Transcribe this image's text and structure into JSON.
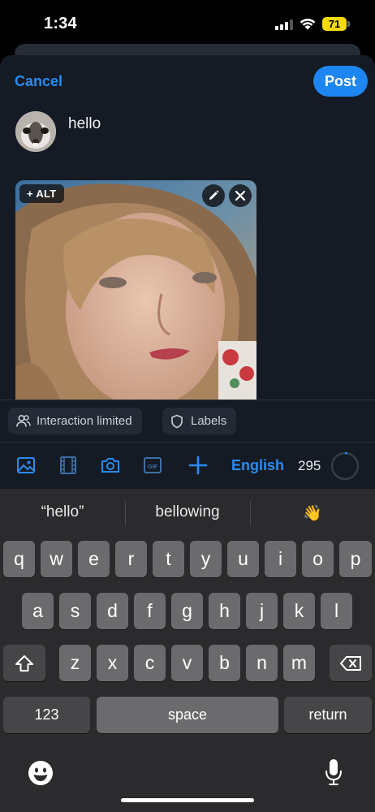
{
  "status_bar": {
    "time": "1:34",
    "battery": "71"
  },
  "composer": {
    "cancel_label": "Cancel",
    "post_label": "Post",
    "text": "hello",
    "alt_label": "+ ALT"
  },
  "controls": {
    "interaction_label": "Interaction limited",
    "labels_label": "Labels"
  },
  "toolbar": {
    "icons": [
      "image-icon",
      "video-icon",
      "camera-icon",
      "gif-icon",
      "plus-icon"
    ],
    "language": "English",
    "char_count": "295"
  },
  "keyboard": {
    "suggestions": [
      "“hello”",
      "bellowing",
      "👋"
    ],
    "row1": [
      "q",
      "w",
      "e",
      "r",
      "t",
      "y",
      "u",
      "i",
      "o",
      "p"
    ],
    "row2": [
      "a",
      "s",
      "d",
      "f",
      "g",
      "h",
      "j",
      "k",
      "l"
    ],
    "row3": [
      "z",
      "x",
      "c",
      "v",
      "b",
      "n",
      "m"
    ],
    "numbers_label": "123",
    "space_label": "space",
    "return_label": "return"
  },
  "colors": {
    "accent": "#1e86f0",
    "background": "#151b24",
    "keyboard": "#2b2b2d"
  }
}
